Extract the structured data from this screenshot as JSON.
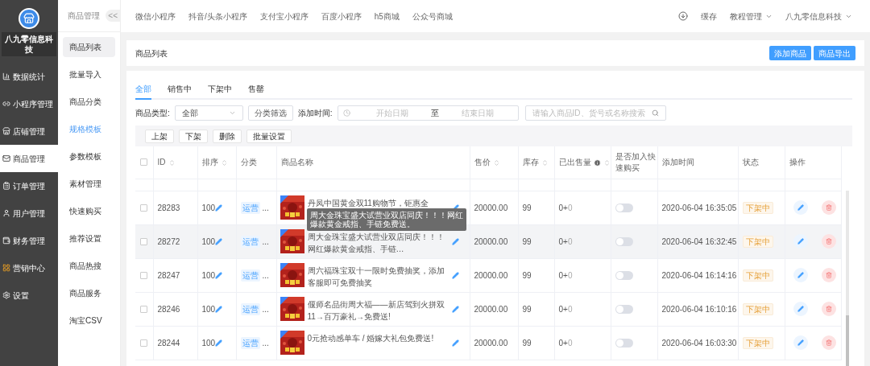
{
  "sidebar": {
    "company": "八九零信息科技",
    "items": [
      {
        "label": "数据统计",
        "selected": false
      },
      {
        "label": "小程序管理",
        "selected": false
      },
      {
        "label": "店铺管理",
        "selected": false
      },
      {
        "label": "商品管理",
        "selected": true
      },
      {
        "label": "订单管理",
        "selected": false
      },
      {
        "label": "用户管理",
        "selected": false
      },
      {
        "label": "财务管理",
        "selected": false
      },
      {
        "label": "营销中心",
        "selected": false
      },
      {
        "label": "设置",
        "selected": false
      }
    ]
  },
  "subnav": {
    "title": "商品管理",
    "collapse": "<<",
    "items": [
      {
        "label": "商品列表",
        "selected": true,
        "highlighted": false
      },
      {
        "label": "批量导入",
        "selected": false,
        "highlighted": false
      },
      {
        "label": "商品分类",
        "selected": false,
        "highlighted": false
      },
      {
        "label": "规格模板",
        "selected": false,
        "highlighted": true
      },
      {
        "label": "参数模板",
        "selected": false,
        "highlighted": false
      },
      {
        "label": "素材管理",
        "selected": false,
        "highlighted": false
      },
      {
        "label": "快速购买",
        "selected": false,
        "highlighted": false
      },
      {
        "label": "推荐设置",
        "selected": false,
        "highlighted": false
      },
      {
        "label": "商品热搜",
        "selected": false,
        "highlighted": false
      },
      {
        "label": "商品服务",
        "selected": false,
        "highlighted": false
      },
      {
        "label": "淘宝CSV",
        "selected": false,
        "highlighted": false
      }
    ]
  },
  "topbar": {
    "channels": [
      "微信小程序",
      "抖音/头条小程序",
      "支付宝小程序",
      "百度小程序",
      "h5商城",
      "公众号商城"
    ],
    "right": [
      {
        "kind": "link",
        "label": "缓存"
      },
      {
        "kind": "menu",
        "label": "教程管理"
      },
      {
        "kind": "menu",
        "label": "八九零信息科技"
      }
    ]
  },
  "header": {
    "title": "商品列表",
    "buttons": [
      "添加商品",
      "商品导出"
    ]
  },
  "tabs": [
    {
      "label": "全部",
      "selected": true
    },
    {
      "label": "销售中",
      "selected": false
    },
    {
      "label": "下架中",
      "selected": false
    },
    {
      "label": "售罄",
      "selected": false
    }
  ],
  "filters": {
    "type_label": "商品类型:",
    "type_value": "全部",
    "category_button": "分类筛选",
    "time_label": "添加时间:",
    "start_placeholder": "开始日期",
    "separator": "至",
    "end_placeholder": "结束日期",
    "search_placeholder": "请输入商品ID、货号或名称搜索"
  },
  "actions": [
    "上架",
    "下架",
    "删除",
    "批量设置"
  ],
  "table": {
    "all_checked": false,
    "columns": [
      {
        "label": "ID",
        "sortable": true,
        "info": false
      },
      {
        "label": "排序",
        "sortable": true,
        "info": false
      },
      {
        "label": "分类",
        "sortable": false,
        "info": false
      },
      {
        "label": "商品名称",
        "sortable": false,
        "info": false
      },
      {
        "label": "售价",
        "sortable": true,
        "info": false
      },
      {
        "label": "库存",
        "sortable": true,
        "info": false
      },
      {
        "label": "已出售量",
        "sortable": true,
        "info": true
      },
      {
        "label": "是否加入快速购买",
        "sortable": false,
        "info": false
      },
      {
        "label": "添加时间",
        "sortable": false,
        "info": false
      },
      {
        "label": "状态",
        "sortable": false,
        "info": false
      },
      {
        "label": "操作",
        "sortable": false,
        "info": false
      }
    ],
    "rows": [
      {
        "checked": false,
        "id": "28283",
        "sort": "100",
        "category": "运营",
        "more": "...",
        "name": "丹凤中国黄金双11购物节，钜惠全",
        "price": "20000.00",
        "stock": "99",
        "sold": "0+",
        "sold_extra": "0",
        "quick_buy": false,
        "time": "2020-06-04 16:35:05",
        "status": "下架中",
        "highlighted": false
      },
      {
        "checked": false,
        "id": "28272",
        "sort": "100",
        "category": "运营",
        "more": "...",
        "name": "周大金珠宝盛大试营业双店同庆！！！网红爆款黄金戒指、手链…",
        "price": "20000.00",
        "stock": "99",
        "sold": "0+",
        "sold_extra": "0",
        "quick_buy": false,
        "time": "2020-06-04 16:32:45",
        "status": "下架中",
        "highlighted": true
      },
      {
        "checked": false,
        "id": "28247",
        "sort": "100",
        "category": "运营",
        "more": "...",
        "name": "周六福珠宝双十一限时免费抽奖，添加客服即可免费抽奖",
        "price": "20000.00",
        "stock": "99",
        "sold": "0+",
        "sold_extra": "0",
        "quick_buy": false,
        "time": "2020-06-04 16:14:16",
        "status": "下架中",
        "highlighted": false
      },
      {
        "checked": false,
        "id": "28246",
        "sort": "100",
        "category": "运营",
        "more": "...",
        "name": "偃师名品街周大福——新店驾到火拼双11→百万豪礼→免费送!",
        "price": "20000.00",
        "stock": "99",
        "sold": "0+",
        "sold_extra": "0",
        "quick_buy": false,
        "time": "2020-06-04 16:10:16",
        "status": "下架中",
        "highlighted": false
      },
      {
        "checked": false,
        "id": "28244",
        "sort": "100",
        "category": "运营",
        "more": "...",
        "name": "0元抢动感单车 / 婚嫁大礼包免费送!",
        "price": "20000.00",
        "stock": "99",
        "sold": "0+",
        "sold_extra": "0",
        "quick_buy": false,
        "time": "2020-06-04 16:03:30",
        "status": "下架中",
        "highlighted": false
      }
    ]
  },
  "tooltip": "周大金珠宝盛大试营业双店同庆！！！网红爆款黄金戒指、手链免费送。"
}
